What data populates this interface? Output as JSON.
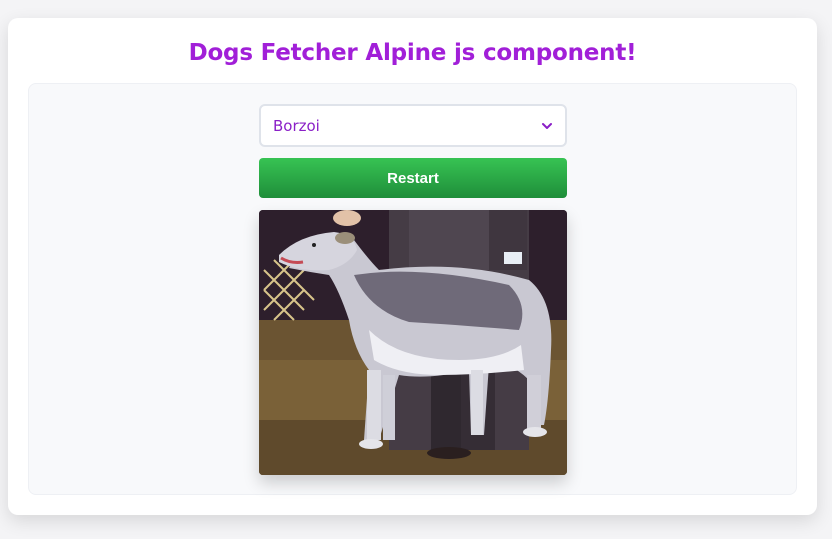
{
  "title": "Dogs Fetcher Alpine js component!",
  "breed_select": {
    "selected": "Borzoi"
  },
  "restart_button": {
    "label": "Restart"
  },
  "colors": {
    "title": "#a11fd8",
    "select_text": "#8a1fc7",
    "button_top": "#37c353",
    "button_bottom": "#1f8e3a"
  },
  "icons": {
    "select_arrow": "chevron-down-icon"
  }
}
